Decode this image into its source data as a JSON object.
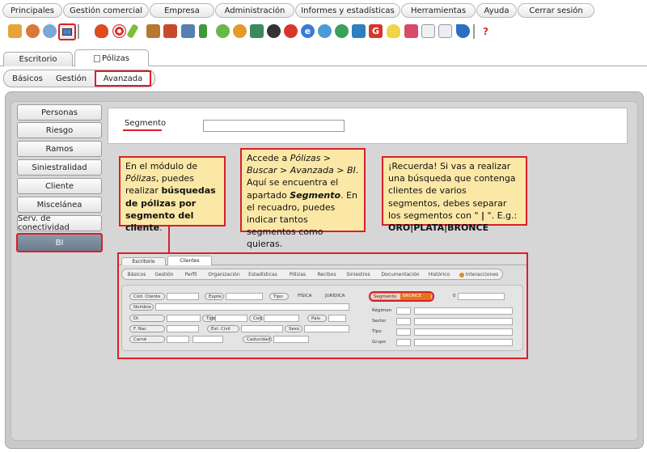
{
  "menu": {
    "items": [
      "Principales",
      "Gestión comercial",
      "Empresa",
      "Administración",
      "Informes y estadísticas",
      "Herramientas",
      "Ayuda",
      "Cerrar sesión"
    ]
  },
  "toolbar": {
    "icons": [
      "cube-icon",
      "users-icon",
      "person-icon",
      "monitor-icon",
      "fire-icon",
      "target-icon",
      "pencil-icon",
      "briefcase-icon",
      "bag-icon",
      "car-icon",
      "battery-icon",
      "user-green-icon",
      "user-orange-icon",
      "stamp-icon",
      "clock-icon",
      "refresh-icon",
      "e-icon",
      "arrows-icon",
      "compass-icon",
      "sync-icon",
      "g-icon",
      "bulb-icon",
      "badge-icon",
      "notepad-icon",
      "document-icon",
      "phone-icon",
      "help-icon"
    ]
  },
  "tabs": {
    "escritorio": "Escritorio",
    "polizas": "Pólizas"
  },
  "subtabs": {
    "basicos": "Básicos",
    "gestion": "Gestión",
    "avanzada": "Avanzada"
  },
  "sidebar": {
    "items": [
      "Personas",
      "Riesgo",
      "Ramos",
      "Siniestralidad",
      "Cliente",
      "Miscelánea",
      "Serv. de conectividad",
      "BI"
    ]
  },
  "form": {
    "segmento_label": "Segmento",
    "segmento_value": ""
  },
  "callout1": {
    "t1": "En el módulo de ",
    "t2": "Pólizas",
    "t3": ", puedes realizar ",
    "t4": "búsquedas de pólizas por segmento del cliente",
    "t5": "."
  },
  "callout2": {
    "t1": "Accede a ",
    "t2": "Pólizas > Buscar > Avanzada > BI",
    "t3": ". Aquí se encuentra el apartado ",
    "t4": "Segmento",
    "t5": ". En el recuadro, puedes indicar tantos segmentos como quieras."
  },
  "callout3": {
    "t1": "¡Recuerda! Si vas a realizar una búsqueda que contenga clientes de varios segmentos, debes separar los segmentos con \" ",
    "t2": "|",
    "t3": " \". E.g.: ",
    "t4": "ORO|PLATA|BRONCE"
  },
  "inset": {
    "tabs": [
      "Escritorio",
      "Clientes"
    ],
    "subtabs": [
      "Básicos",
      "Gestión",
      "Perfil",
      "Organización",
      "Estadísticas",
      "Pólizas",
      "Recibos",
      "Siniestros",
      "Documentación",
      "Histórico",
      "Interacciones"
    ],
    "fields": {
      "cod_cliente": "Cód. Cliente",
      "expte": "Expte.",
      "tipo": "Tipo",
      "fisica": "FÍSICA",
      "juridica": "JURÍDICA",
      "nombre": "Nombre",
      "di": "DI",
      "tipo2": "Tipo",
      "cod": "Cod.",
      "pais": "País",
      "f_nac": "F. Nac",
      "est_civil": "Est. Civil",
      "sexo": "Sexo",
      "carne": "Carné",
      "caducidad": "Caducidad",
      "segmento": "Segmento",
      "segmento_value": "BRONCE",
      "zero": "0",
      "regimen": "Régimen",
      "sector": "Sector",
      "tipo3": "Tipo",
      "grupo": "Grupo"
    }
  },
  "colors": {
    "highlight": "#d8202a",
    "callout_bg": "#fbe8a6",
    "segment_badge": "#e8731a"
  }
}
